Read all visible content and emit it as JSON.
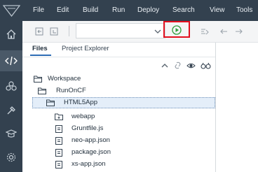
{
  "menubar": {
    "logo_icon": "sap-logo-icon",
    "items": [
      "File",
      "Edit",
      "Build",
      "Run",
      "Deploy",
      "Search",
      "View",
      "Tools"
    ]
  },
  "activity": {
    "items": [
      {
        "name": "home-icon"
      },
      {
        "name": "development-icon",
        "active": true
      },
      {
        "name": "plugins-icon"
      },
      {
        "name": "tools-icon"
      },
      {
        "name": "learning-icon"
      },
      {
        "name": "preferences-icon"
      }
    ]
  },
  "toolbar": {
    "icons": [
      "undo-icon",
      "redo-icon",
      "dropdown-icon",
      "run-icon",
      "debug-icon",
      "back-icon",
      "forward-icon"
    ],
    "run_color": "#2e9e3b",
    "highlight_color": "#e3101f"
  },
  "panel": {
    "tabs": [
      "Files",
      "Project Explorer"
    ],
    "active_tab": "Files",
    "tools": [
      "collapse-icon",
      "link-icon",
      "show-hidden-icon",
      "search-icon"
    ]
  },
  "tree": [
    {
      "label": "Workspace",
      "icon": "folder-open-icon"
    },
    {
      "label": "RunOnCF",
      "icon": "folder-open-icon"
    },
    {
      "label": "HTML5App",
      "icon": "folder-open-icon",
      "selected": true
    },
    {
      "label": "webapp",
      "icon": "folder-closed-icon"
    },
    {
      "label": "Gruntfile.js",
      "icon": "file-icon"
    },
    {
      "label": "neo-app.json",
      "icon": "file-icon"
    },
    {
      "label": "package.json",
      "icon": "file-icon"
    },
    {
      "label": "xs-app.json",
      "icon": "file-icon"
    }
  ]
}
